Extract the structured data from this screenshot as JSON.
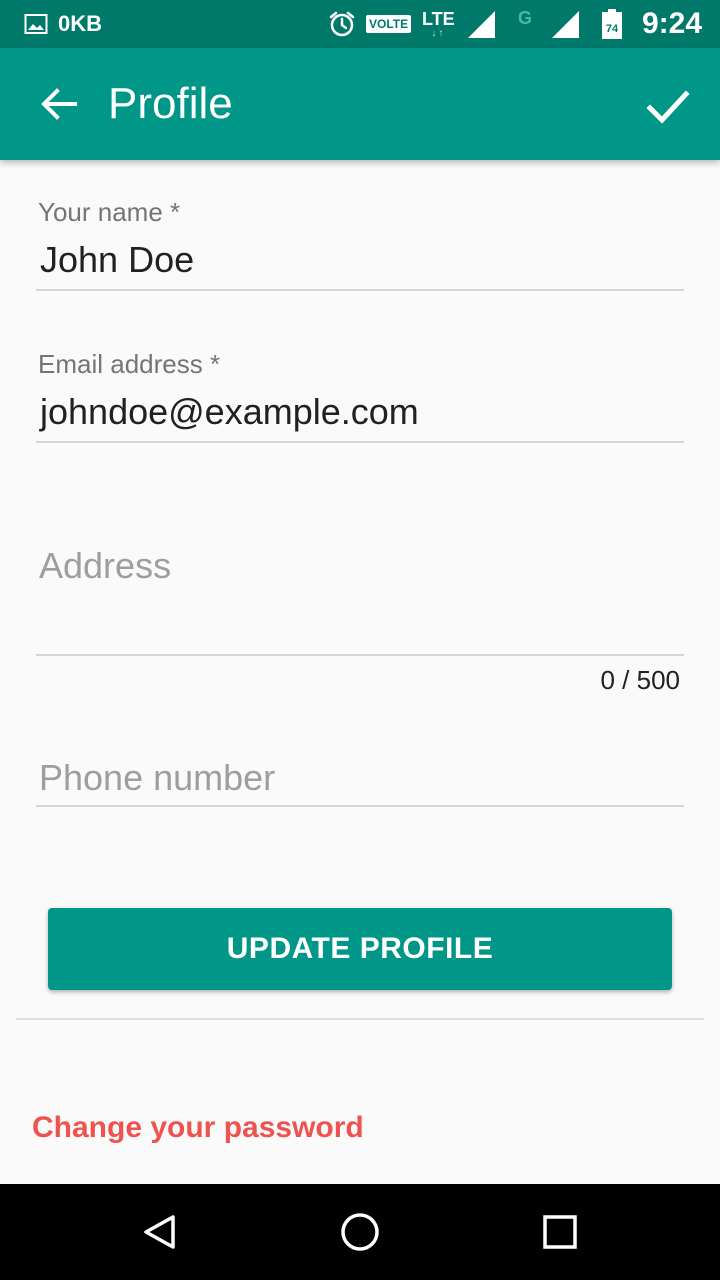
{
  "status_bar": {
    "data_counter": "0KB",
    "volte": "VOLTE",
    "network": "LTE",
    "network_arrows": "↓↑",
    "secondary_network": "G",
    "battery_level": "74",
    "time": "9:24",
    "icons": [
      "image-icon",
      "alarm-icon",
      "signal-icon",
      "battery-icon"
    ]
  },
  "app_bar": {
    "title": "Profile",
    "back_icon": "arrow-back-icon",
    "confirm_icon": "check-icon"
  },
  "form": {
    "name": {
      "label": "Your name *",
      "value": "John Doe"
    },
    "email": {
      "label": "Email address *",
      "value": "johndoe@example.com"
    },
    "address": {
      "placeholder": "Address",
      "value": "",
      "counter": "0 / 500"
    },
    "phone": {
      "placeholder": "Phone number",
      "value": ""
    }
  },
  "actions": {
    "update_label": "UPDATE PROFILE",
    "change_password_label": "Change your password"
  },
  "colors": {
    "status_bar": "#00796b",
    "primary": "#009688",
    "link": "#ef5350",
    "background": "#fafafa"
  },
  "nav_bar": {
    "icons": [
      "back-triangle-icon",
      "home-circle-icon",
      "recents-square-icon"
    ]
  }
}
